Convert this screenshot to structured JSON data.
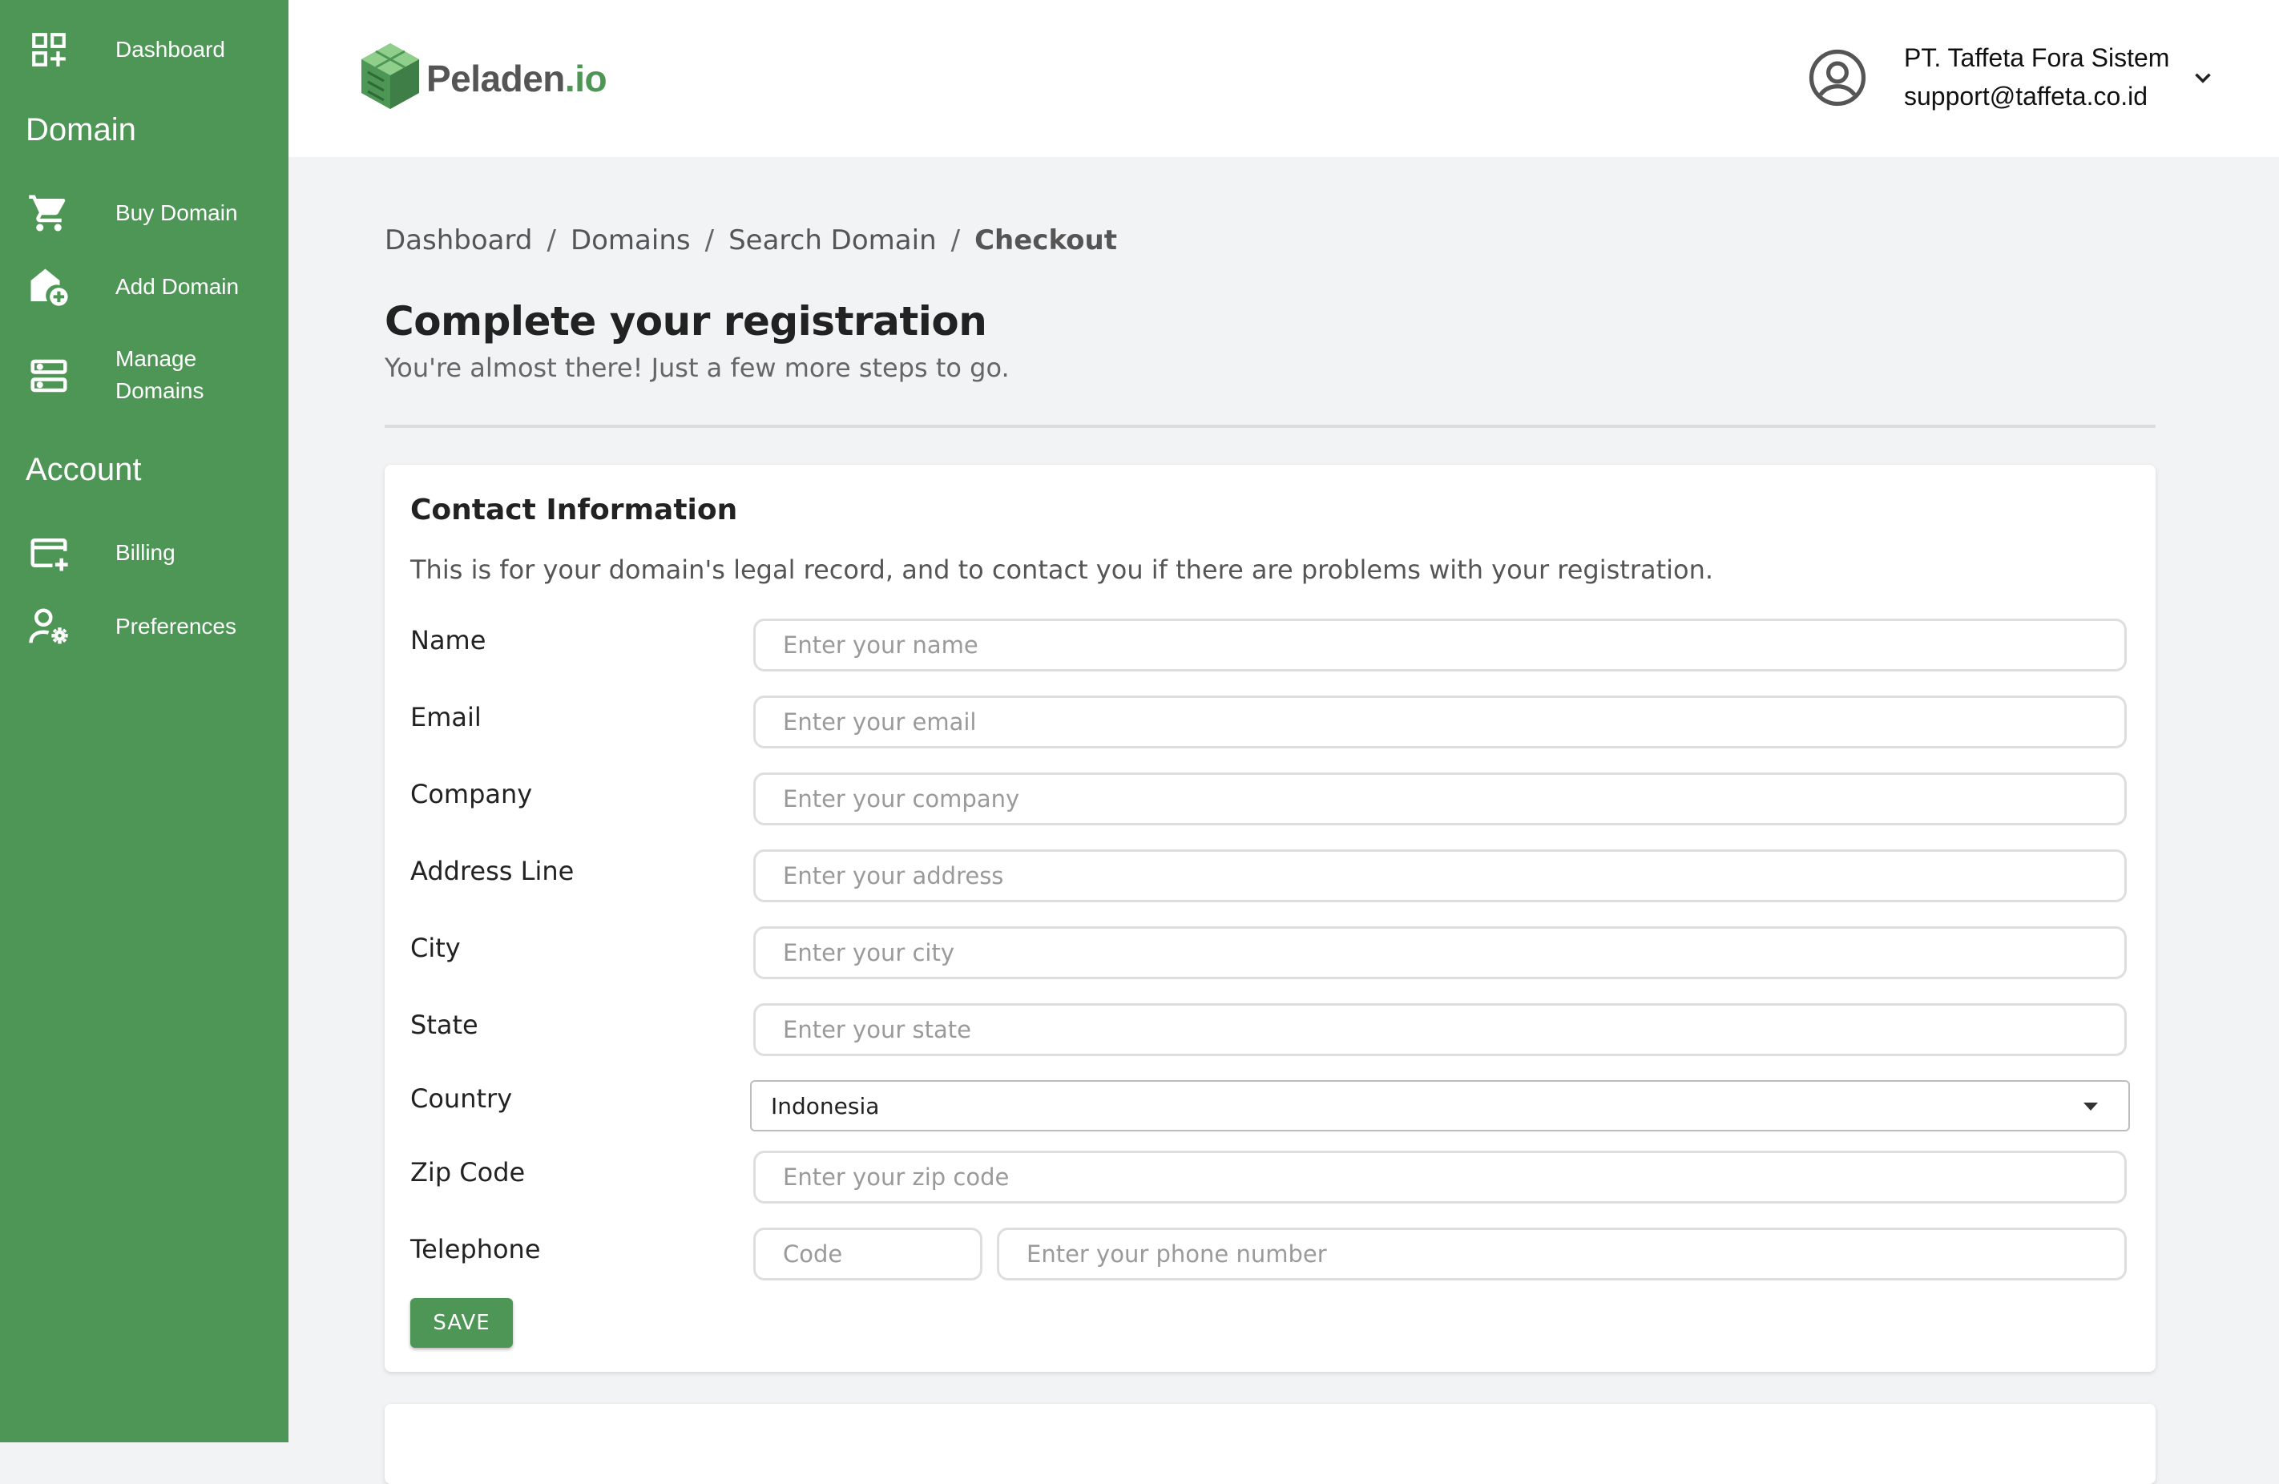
{
  "sidebar": {
    "items": [
      {
        "label": "Dashboard",
        "icon": "dashboard-icon"
      },
      {
        "label": "Buy Domain",
        "icon": "cart-icon"
      },
      {
        "label": "Add Domain",
        "icon": "add-home-icon"
      },
      {
        "label": "Manage\nDomains",
        "icon": "dns-icon"
      },
      {
        "label": "Billing",
        "icon": "card-add-icon"
      },
      {
        "label": "Preferences",
        "icon": "user-settings-icon"
      }
    ],
    "sections": {
      "domain": "Domain",
      "account": "Account"
    }
  },
  "header": {
    "logo_name": "Peladen",
    "logo_tld": ".io",
    "user_name": "PT. Taffeta Fora Sistem",
    "user_email": "support@taffeta.co.id"
  },
  "breadcrumb": {
    "items": [
      "Dashboard",
      "Domains",
      "Search Domain"
    ],
    "current": "Checkout",
    "separator": "/"
  },
  "page": {
    "title": "Complete your registration",
    "subtitle": "You're almost there! Just a few more steps to go."
  },
  "contact": {
    "title": "Contact Information",
    "description": "This is for your domain's legal record, and to contact you if there are problems with your registration.",
    "fields": {
      "name": {
        "label": "Name",
        "placeholder": "Enter your name"
      },
      "email": {
        "label": "Email",
        "placeholder": "Enter your email"
      },
      "company": {
        "label": "Company",
        "placeholder": "Enter your company"
      },
      "address": {
        "label": "Address Line",
        "placeholder": "Enter your address"
      },
      "city": {
        "label": "City",
        "placeholder": "Enter your city"
      },
      "state": {
        "label": "State",
        "placeholder": "Enter your state"
      },
      "country": {
        "label": "Country",
        "value": "Indonesia"
      },
      "zip": {
        "label": "Zip Code",
        "placeholder": "Enter your zip code"
      },
      "telephone": {
        "label": "Telephone",
        "code_placeholder": "Code",
        "placeholder": "Enter your phone number"
      }
    },
    "save_label": "SAVE"
  },
  "colors": {
    "brand": "#4e9656",
    "background": "#f2f3f4"
  }
}
